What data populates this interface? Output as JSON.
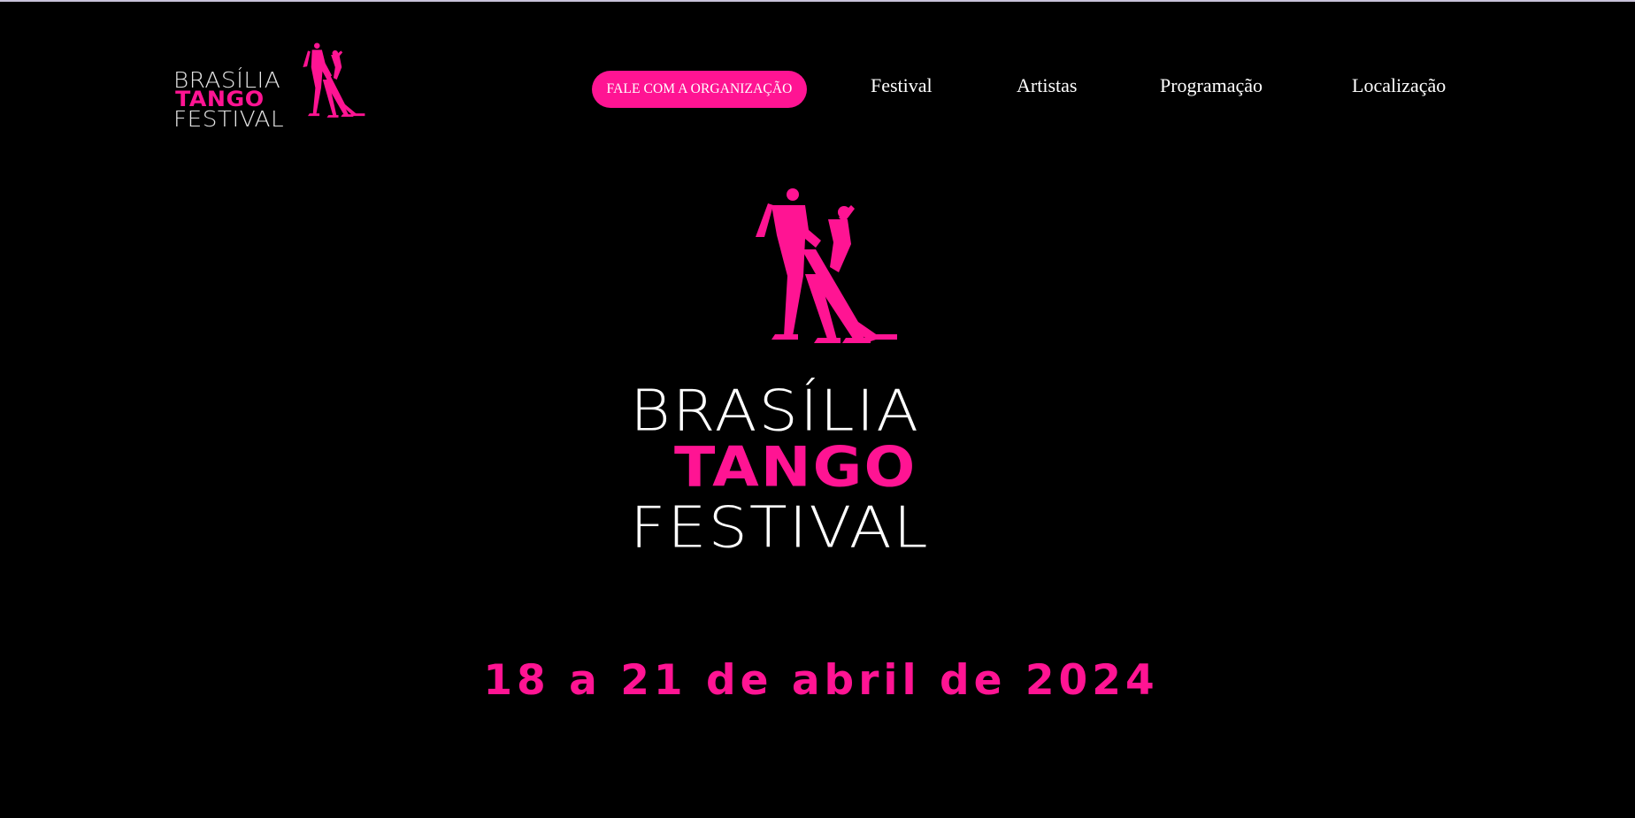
{
  "header": {
    "logo": {
      "line1": "BRASÍLIA",
      "line2": "TANGO",
      "line3": "FESTIVAL"
    },
    "nav": {
      "cta_label": "FALE COM A ORGANIZAÇÃO",
      "items": [
        {
          "label": "Festival"
        },
        {
          "label": "Artistas"
        },
        {
          "label": "Programação"
        },
        {
          "label": "Localização"
        }
      ]
    }
  },
  "hero": {
    "wordmark": {
      "line1": "BRASÍLIA",
      "line2": "TANGO",
      "line3": "FESTIVAL"
    },
    "date": "18 a 21 de abril de 2024"
  },
  "theme": {
    "background": "#000000",
    "accent": "#ff1493",
    "text": "#ffffff"
  },
  "icons": {
    "logo_emblem": "tango-dancers-icon"
  }
}
